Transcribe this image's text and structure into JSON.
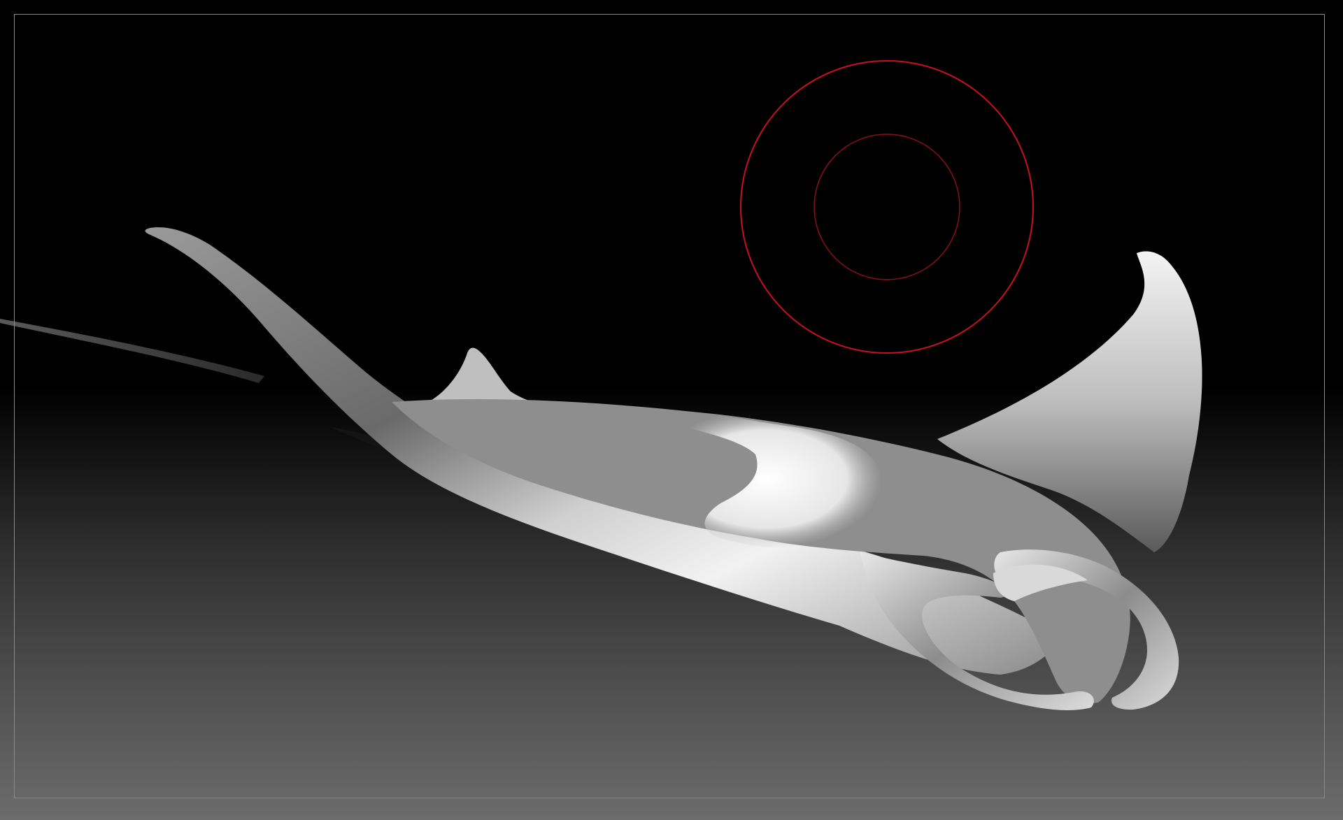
{
  "app": {
    "title": ""
  },
  "viewport": {
    "background_top": "#000000",
    "background_bottom": "#6c6c6c",
    "border_color": "#8a8a8a"
  },
  "model": {
    "material_color": "#d8d8d8",
    "shadow_color": "#2a2a2a"
  },
  "brush_cursor": {
    "outer_ring_color": "#c8101e",
    "inner_ring_color": "#8a0f16"
  },
  "icons": {
    "brush": "brush-cursor-icon"
  }
}
